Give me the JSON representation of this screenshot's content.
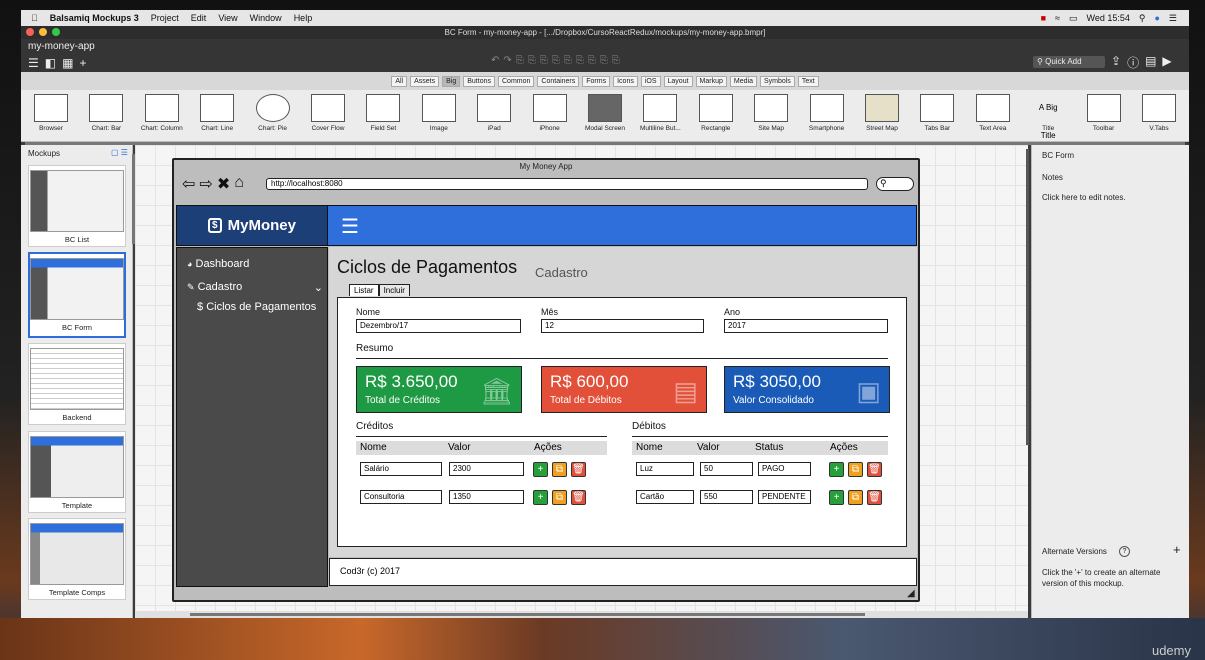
{
  "menubar": {
    "app": "Balsamiq Mockups 3",
    "items": [
      "Project",
      "Edit",
      "View",
      "Window",
      "Help"
    ],
    "clock": "Wed 15:54"
  },
  "window": {
    "title": "BC Form - my-money-app - [.../Dropbox/CursoReactRedux/mockups/my-money-app.bmpr]",
    "project": "my-money-app",
    "quick_add": "Quick Add"
  },
  "categories": [
    "All",
    "Assets",
    "Big",
    "Buttons",
    "Common",
    "Containers",
    "Forms",
    "Icons",
    "iOS",
    "Layout",
    "Markup",
    "Media",
    "Symbols",
    "Text"
  ],
  "active_category": "Big",
  "library": [
    "Browser",
    "Chart: Bar",
    "Chart: Column",
    "Chart: Line",
    "Chart: Pie",
    "Cover Flow",
    "Field Set",
    "Image",
    "iPad",
    "iPhone",
    "Modal Screen",
    "Multiline But...",
    "Rectangle",
    "Site Map",
    "Smartphone",
    "Street Map",
    "Tabs Bar",
    "Text Area",
    "Title",
    "Toolbar",
    "V.Tabs"
  ],
  "library_title_sample": "A Big Title",
  "left_panel": {
    "title": "Mockups",
    "thumbs": [
      "BC List",
      "BC Form",
      "Backend",
      "Template",
      "Template Comps"
    ]
  },
  "right_panel": {
    "title": "BC Form",
    "notes_label": "Notes",
    "notes_hint": "Click here to edit notes.",
    "alt_title": "Alternate Versions",
    "alt_hint": "Click the '+' to create an alternate version of this mockup."
  },
  "mockup": {
    "browser_title": "My Money App",
    "url": "http://localhost:8080",
    "logo": "MyMoney",
    "sidebar": {
      "dashboard": "Dashboard",
      "cadastro": "Cadastro",
      "ciclos": "Ciclos de Pagamentos"
    },
    "title": "Ciclos de Pagamentos",
    "subtitle": "Cadastro",
    "tabs": [
      "Listar",
      "Incluir"
    ],
    "form": {
      "nome_label": "Nome",
      "nome_value": "Dezembro/17",
      "mes_label": "Mês",
      "mes_value": "12",
      "ano_label": "Ano",
      "ano_value": "2017"
    },
    "resumo": "Resumo",
    "boxes": [
      {
        "value": "R$ 3.650,00",
        "label": "Total de Créditos",
        "color": "#1f9a44"
      },
      {
        "value": "R$ 600,00",
        "label": "Total de Débitos",
        "color": "#e2503a"
      },
      {
        "value": "R$ 3050,00",
        "label": "Valor Consolidado",
        "color": "#1a5bb8"
      }
    ],
    "creditos": {
      "title": "Créditos",
      "headers": [
        "Nome",
        "Valor",
        "Ações"
      ],
      "rows": [
        {
          "nome": "Salário",
          "valor": "2300"
        },
        {
          "nome": "Consultoria",
          "valor": "1350"
        }
      ]
    },
    "debitos": {
      "title": "Débitos",
      "headers": [
        "Nome",
        "Valor",
        "Status",
        "Ações"
      ],
      "rows": [
        {
          "nome": "Luz",
          "valor": "50",
          "status": "PAGO"
        },
        {
          "nome": "Cartão",
          "valor": "550",
          "status": "PENDENTE"
        }
      ]
    },
    "footer": "Cod3r (c) 2017"
  },
  "watermark": "udemy"
}
